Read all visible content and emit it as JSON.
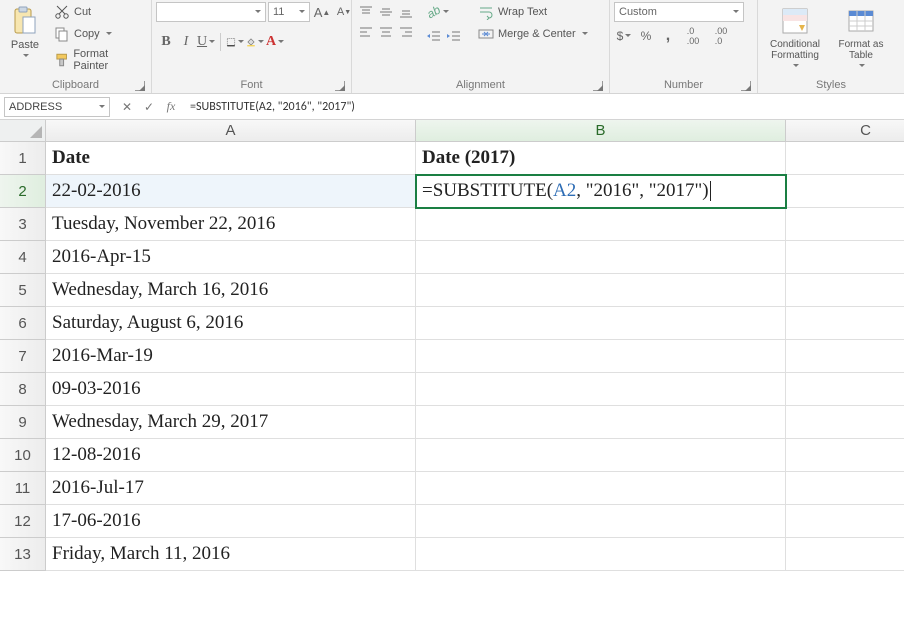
{
  "ribbon": {
    "clipboard": {
      "paste": "Paste",
      "cut": "Cut",
      "copy": "Copy",
      "format_painter": "Format Painter",
      "label": "Clipboard"
    },
    "font": {
      "size": "11",
      "increase_tip": "A",
      "decrease_tip": "A",
      "bold": "B",
      "italic": "I",
      "underline": "U",
      "label": "Font"
    },
    "alignment": {
      "wrap": "Wrap Text",
      "merge": "Merge & Center",
      "label": "Alignment"
    },
    "number": {
      "format": "Custom",
      "currency": "$",
      "percent": "%",
      "comma": ",",
      "inc_dec": ".0",
      "dec_dec": ".00",
      "label": "Number"
    },
    "styles": {
      "conditional": "Conditional Formatting",
      "table": "Format as Table",
      "label": "Styles"
    }
  },
  "namebox": "ADDRESS",
  "formula": "=SUBSTITUTE(A2, \"2016\", \"2017\")",
  "columns": [
    "A",
    "B",
    "C"
  ],
  "rows": [
    "1",
    "2",
    "3",
    "4",
    "5",
    "6",
    "7",
    "8",
    "9",
    "10",
    "11",
    "12",
    "13"
  ],
  "header": {
    "A": "Date",
    "B": "Date (2017)"
  },
  "colA_values": [
    "22-02-2016",
    "Tuesday, November 22, 2016",
    "2016-Apr-15",
    "Wednesday, March 16, 2016",
    "Saturday, August 6, 2016",
    "2016-Mar-19",
    "09-03-2016",
    "Wednesday, March 29, 2017",
    "12-08-2016",
    "2016-Jul-17",
    "17-06-2016",
    "Friday, March 11, 2016"
  ],
  "b2_display": {
    "prefix": "=SUBSTITUTE(",
    "ref": "A2",
    "suffix": ", \"2016\", \"2017\")"
  }
}
